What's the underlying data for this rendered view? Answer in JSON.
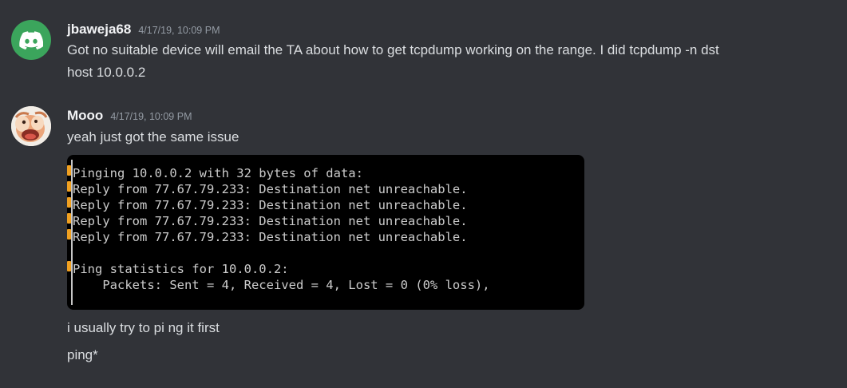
{
  "messages": [
    {
      "username": "jbaweja68",
      "timestamp": "4/17/19, 10:09 PM",
      "lines": [
        "Got no suitable device will email the TA about how to get tcpdump working on the range. I did tcpdump -n dst",
        "host 10.0.0.2"
      ]
    },
    {
      "username": "Mooo",
      "timestamp": "4/17/19, 10:09 PM",
      "text": "yeah just got the same issue",
      "attachment": {
        "terminal_lines": [
          "Pinging 10.0.0.2 with 32 bytes of data:",
          "Reply from 77.67.79.233: Destination net unreachable.",
          "Reply from 77.67.79.233: Destination net unreachable.",
          "Reply from 77.67.79.233: Destination net unreachable.",
          "Reply from 77.67.79.233: Destination net unreachable.",
          "",
          "Ping statistics for 10.0.0.2:",
          "    Packets: Sent = 4, Received = 4, Lost = 0 (0% loss),"
        ]
      },
      "followups": [
        "i usually try to pi ng it first",
        "ping*"
      ]
    }
  ],
  "colors": {
    "background": "#313338",
    "username": "#f2f3f5",
    "timestamp": "#949ba4",
    "text": "#dbdee1",
    "discord_avatar": "#3ba55c",
    "terminal_bg": "#000000",
    "terminal_text": "#cccccc"
  },
  "icons": {
    "avatar_1": "discord-logo-icon",
    "avatar_2": "cartoon-character-avatar"
  }
}
